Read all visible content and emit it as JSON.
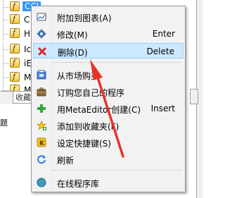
{
  "navigator": {
    "items": [
      {
        "label": "CCI",
        "selected": true
      },
      {
        "label": "C"
      },
      {
        "label": "H"
      },
      {
        "label": "Ic"
      },
      {
        "label": "iE"
      },
      {
        "label": "M"
      },
      {
        "label": "M"
      }
    ],
    "tab_label": "收藏",
    "status_text": "题"
  },
  "menu": {
    "items": [
      {
        "label": "附加到图表(A)",
        "shortcut": "",
        "icon": "chart-attach-icon"
      },
      {
        "label": "修改(M)",
        "shortcut": "Enter",
        "icon": "gear-icon"
      },
      {
        "label": "删除(D)",
        "shortcut": "Delete",
        "icon": "delete-x-icon"
      },
      {
        "label": "从市场购买",
        "shortcut": "",
        "icon": "market-icon"
      },
      {
        "label": "订购您自己的程序",
        "shortcut": "",
        "icon": "briefcase-icon"
      },
      {
        "label": "用MetaEditor创建(C)",
        "shortcut": "Insert",
        "icon": "plus-icon"
      },
      {
        "label": "添加到收藏夹(F)",
        "shortcut": "",
        "icon": "star-add-icon"
      },
      {
        "label": "设定快捷键(S)",
        "shortcut": "",
        "icon": "hotkey-icon"
      },
      {
        "label": "刷新",
        "shortcut": "",
        "icon": "refresh-icon"
      },
      {
        "label": "在线程序库",
        "shortcut": "",
        "icon": "globe-icon"
      }
    ]
  },
  "colors": {
    "highlight_bg": "#cce8ff",
    "highlight_border": "#99d1ff",
    "selection_blue": "#3399ff",
    "arrow_red": "#e8322b"
  }
}
